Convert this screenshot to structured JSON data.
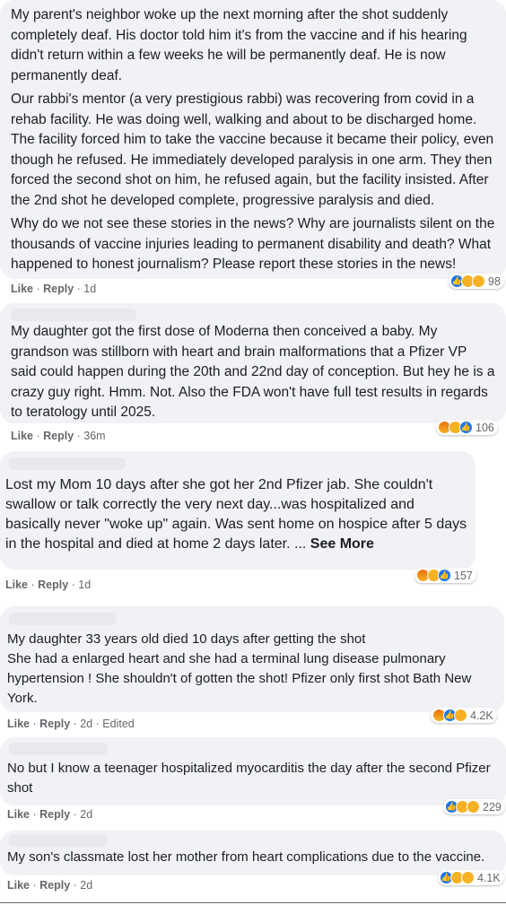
{
  "comments": [
    {
      "paragraphs": [
        "My parent's neighbor woke up the next morning after the shot suddenly completely deaf. His doctor told him it's from the vaccine and if his hearing didn't return within a few weeks he will be permanently deaf. He is now permanently deaf.",
        "Our rabbi's mentor (a very prestigious rabbi) was recovering from covid in a rehab facility. He was doing well, walking and about to be discharged home. The facility forced him to take the vaccine because it became their policy, even though he refused. He immediately developed paralysis in one arm. They then forced the second shot on him, he refused again, but the facility insisted. After the 2nd shot he developed complete, progressive paralysis and died.",
        "Why do we not see these stories in the news? Why are journalists silent on the thousands of vaccine injuries leading to permanent disability and death? What happened to honest journalism? Please report these stories in the news!"
      ],
      "like": "Like",
      "reply": "Reply",
      "time": "1d",
      "edited": "",
      "reactions": [
        "like-icon",
        "care-icon",
        "wow-icon"
      ],
      "count": "98"
    },
    {
      "paragraphs": [
        "My daughter got the first dose of Moderna then conceived a baby. My grandson was stillborn with heart and brain malformations that a Pfizer VP said could happen during the 20th and 22nd day of conception. But hey he is a crazy guy right. Hmm. Not. Also the FDA won't have full test results in regards to teratology until 2025."
      ],
      "like": "Like",
      "reply": "Reply",
      "time": "36m",
      "edited": "",
      "reactions": [
        "angry-icon",
        "care-icon",
        "like-icon"
      ],
      "count": "106"
    },
    {
      "paragraphs": [
        "Lost my Mom 10 days after she got her 2nd Pfizer jab. She couldn't swallow or talk correctly the very next day...was hospitalized and basically never \"woke up\" again. Was sent home on hospice after 5 days in the hospital and died at home 2 days later. ..."
      ],
      "see_more": "See More",
      "like": "Like",
      "reply": "Reply",
      "time": "1d",
      "edited": "",
      "reactions": [
        "angry-icon",
        "care-icon",
        "like-icon"
      ],
      "count": "157"
    },
    {
      "paragraphs": [
        "My daughter 33 years old died 10 days after getting the shot\nShe had a enlarged heart and she had a terminal lung disease pulmonary hypertension ! She shouldn't of gotten the shot! Pfizer only first shot Bath New York."
      ],
      "like": "Like",
      "reply": "Reply",
      "time": "2d",
      "edited": "Edited",
      "reactions": [
        "angry-icon",
        "like-icon",
        "care-icon"
      ],
      "count": "4.2K"
    },
    {
      "paragraphs": [
        "No but I know a teenager hospitalized myocarditis the day after the second Pfizer shot"
      ],
      "like": "Like",
      "reply": "Reply",
      "time": "2d",
      "edited": "",
      "reactions": [
        "like-icon",
        "care-icon",
        "care-icon"
      ],
      "count": "229"
    },
    {
      "paragraphs": [
        "My son's classmate lost her mother from heart complications due to the vaccine."
      ],
      "like": "Like",
      "reply": "Reply",
      "time": "2d",
      "edited": "",
      "reactions": [
        "like-icon",
        "care-icon",
        "care-icon"
      ],
      "count": "4.1K"
    }
  ],
  "colors": {
    "bubble": "#f0f2f5",
    "like_blue": "#1877f2",
    "emoji_yellow": "#f7b125",
    "meta_gray": "#65676b"
  }
}
